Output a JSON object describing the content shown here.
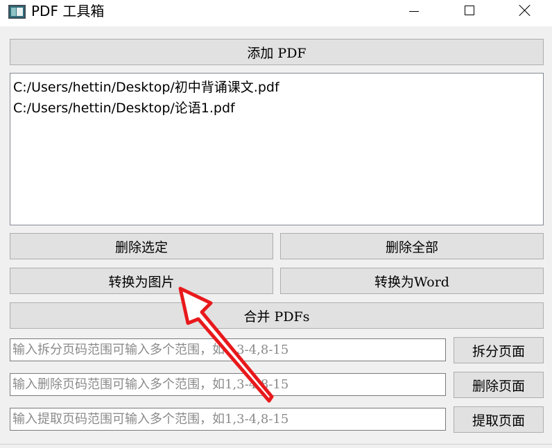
{
  "window": {
    "title": "PDF 工具箱"
  },
  "buttons": {
    "add_pdf": "添加 PDF",
    "delete_selected": "删除选定",
    "delete_all": "删除全部",
    "to_image": "转换为图片",
    "to_word": "转换为Word",
    "merge": "合并 PDFs",
    "split_pages": "拆分页面",
    "delete_pages": "删除页面",
    "extract_pages": "提取页面"
  },
  "file_list": {
    "items": [
      "C:/Users/hettin/Desktop/初中背诵课文.pdf",
      "C:/Users/hettin/Desktop/论语1.pdf"
    ]
  },
  "inputs": {
    "split_placeholder": "输入拆分页码范围可输入多个范围，如1,3-4,8-15",
    "delete_placeholder": "输入删除页码范围可输入多个范围，如1,3-4,8-15",
    "extract_placeholder": "输入提取页码范围可输入多个范围，如1,3-4,8-15"
  },
  "annotation": {
    "arrow_color": "#e8191c"
  }
}
